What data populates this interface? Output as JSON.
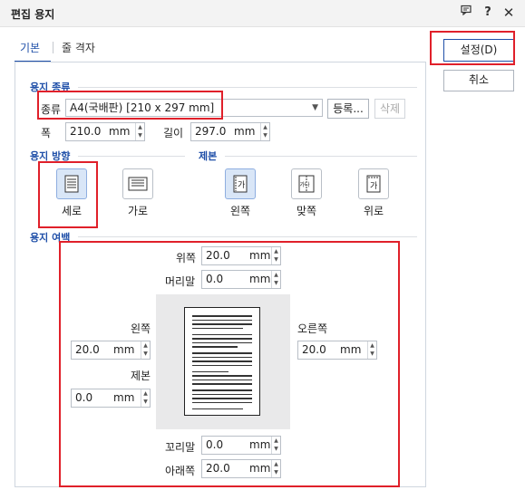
{
  "window": {
    "title": "편집 용지"
  },
  "tabs": [
    {
      "label": "기본"
    },
    {
      "label": "줄 격자"
    }
  ],
  "paper_type": {
    "section": "용지 종류",
    "kind_label": "종류",
    "kind_value": "A4(국배판) [210 x 297 mm]",
    "register_button": "등록...",
    "delete_button": "삭제",
    "width_label": "폭",
    "width_value": "210.0",
    "length_label": "길이",
    "length_value": "297.0",
    "unit": "mm"
  },
  "orientation": {
    "section": "용지 방향",
    "portrait": "세로",
    "landscape": "가로"
  },
  "binding": {
    "section": "제본",
    "left": "왼쪽",
    "facing": "맞쪽",
    "top": "위로",
    "facing_icon_text": "가나",
    "icon_text": "가"
  },
  "margins": {
    "section": "용지 여백",
    "top_label": "위쪽",
    "top_value": "20.0",
    "header_label": "머리말",
    "header_value": "0.0",
    "left_label": "왼쪽",
    "left_value": "20.0",
    "binding_label": "제본",
    "binding_value": "0.0",
    "right_label": "오른쪽",
    "right_value": "20.0",
    "footer_label": "꼬리말",
    "footer_value": "0.0",
    "bottom_label": "아래쪽",
    "bottom_value": "20.0",
    "unit": "mm"
  },
  "buttons": {
    "ok": "설정(D)",
    "cancel": "취소"
  }
}
